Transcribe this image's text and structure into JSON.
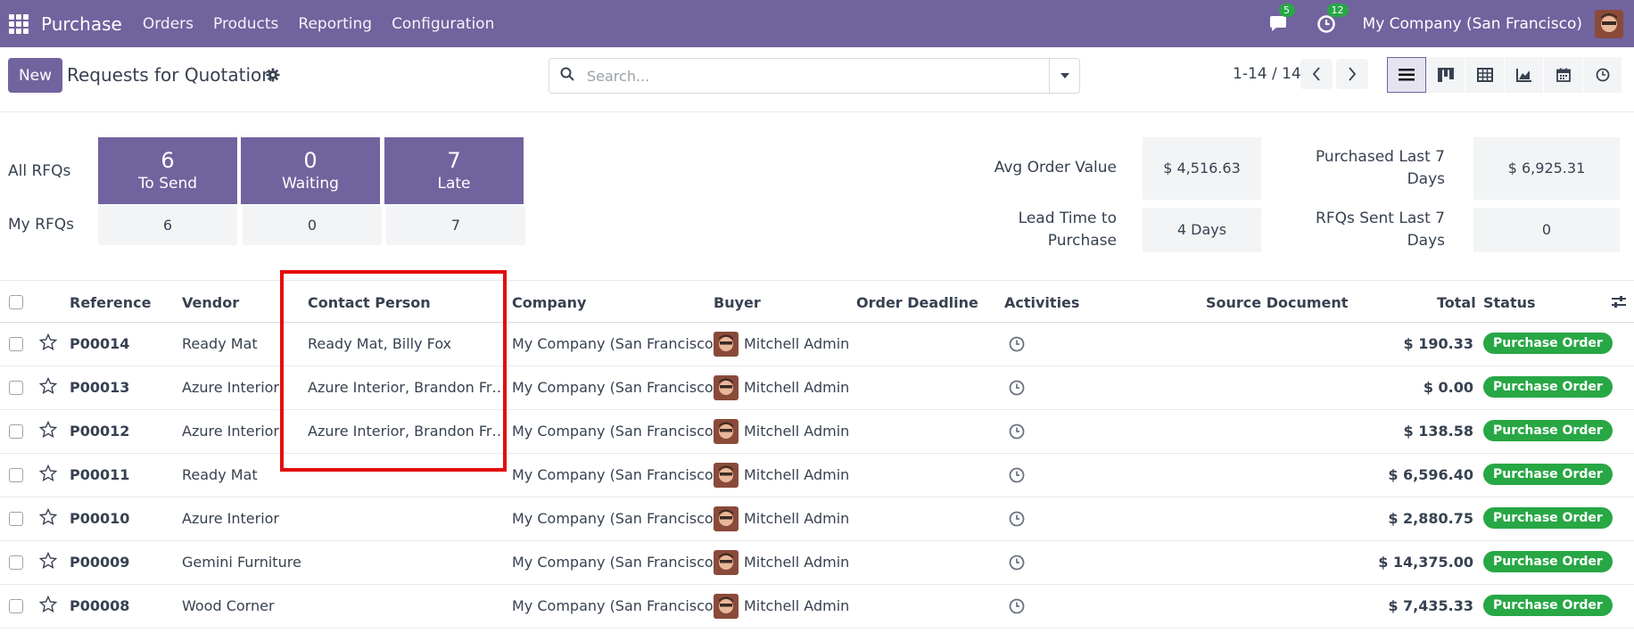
{
  "navbar": {
    "app": "Purchase",
    "menu": [
      "Orders",
      "Products",
      "Reporting",
      "Configuration"
    ],
    "messages_count": "5",
    "activities_count": "12",
    "company": "My Company (San Francisco)"
  },
  "control": {
    "new_label": "New",
    "title": "Requests for Quotation",
    "search_placeholder": "Search...",
    "pager": "1-14 / 14"
  },
  "dashboard": {
    "row1_label": "All RFQs",
    "row2_label": "My RFQs",
    "tiles": [
      {
        "num": "6",
        "label": "To Send",
        "my": "6"
      },
      {
        "num": "0",
        "label": "Waiting",
        "my": "0"
      },
      {
        "num": "7",
        "label": "Late",
        "my": "7"
      }
    ],
    "stats": {
      "avg_order_label": "Avg Order Value",
      "avg_order_value": "$ 4,516.63",
      "purchased_label_1": "Purchased Last 7",
      "purchased_label_2": "Days",
      "purchased_value": "$ 6,925.31",
      "lead_label_1": "Lead Time to",
      "lead_label_2": "Purchase",
      "lead_value": "4 Days",
      "rfqs_label_1": "RFQs Sent Last 7",
      "rfqs_label_2": "Days",
      "rfqs_value": "0"
    }
  },
  "table": {
    "headers": {
      "reference": "Reference",
      "vendor": "Vendor",
      "contact": "Contact Person",
      "company": "Company",
      "buyer": "Buyer",
      "deadline": "Order Deadline",
      "activities": "Activities",
      "source": "Source Document",
      "total": "Total",
      "status": "Status"
    },
    "rows": [
      {
        "ref": "P00014",
        "vendor": "Ready Mat",
        "contact": "Ready Mat, Billy Fox",
        "company": "My Company (San Francisco)",
        "buyer": "Mitchell Admin",
        "total": "$ 190.33",
        "status": "Purchase Order"
      },
      {
        "ref": "P00013",
        "vendor": "Azure Interior",
        "contact": "Azure Interior, Brandon Fr…",
        "company": "My Company (San Francisco)",
        "buyer": "Mitchell Admin",
        "total": "$ 0.00",
        "status": "Purchase Order"
      },
      {
        "ref": "P00012",
        "vendor": "Azure Interior",
        "contact": "Azure Interior, Brandon Fr…",
        "company": "My Company (San Francisco)",
        "buyer": "Mitchell Admin",
        "total": "$ 138.58",
        "status": "Purchase Order"
      },
      {
        "ref": "P00011",
        "vendor": "Ready Mat",
        "contact": "",
        "company": "My Company (San Francisco)",
        "buyer": "Mitchell Admin",
        "total": "$ 6,596.40",
        "status": "Purchase Order"
      },
      {
        "ref": "P00010",
        "vendor": "Azure Interior",
        "contact": "",
        "company": "My Company (San Francisco)",
        "buyer": "Mitchell Admin",
        "total": "$ 2,880.75",
        "status": "Purchase Order"
      },
      {
        "ref": "P00009",
        "vendor": "Gemini Furniture",
        "contact": "",
        "company": "My Company (San Francisco)",
        "buyer": "Mitchell Admin",
        "total": "$ 14,375.00",
        "status": "Purchase Order"
      },
      {
        "ref": "P00008",
        "vendor": "Wood Corner",
        "contact": "",
        "company": "My Company (San Francisco)",
        "buyer": "Mitchell Admin",
        "total": "$ 7,435.33",
        "status": "Purchase Order"
      }
    ]
  },
  "colors": {
    "brand": "#71639e",
    "status_green": "#28a745",
    "highlight": "#e30b0b"
  }
}
